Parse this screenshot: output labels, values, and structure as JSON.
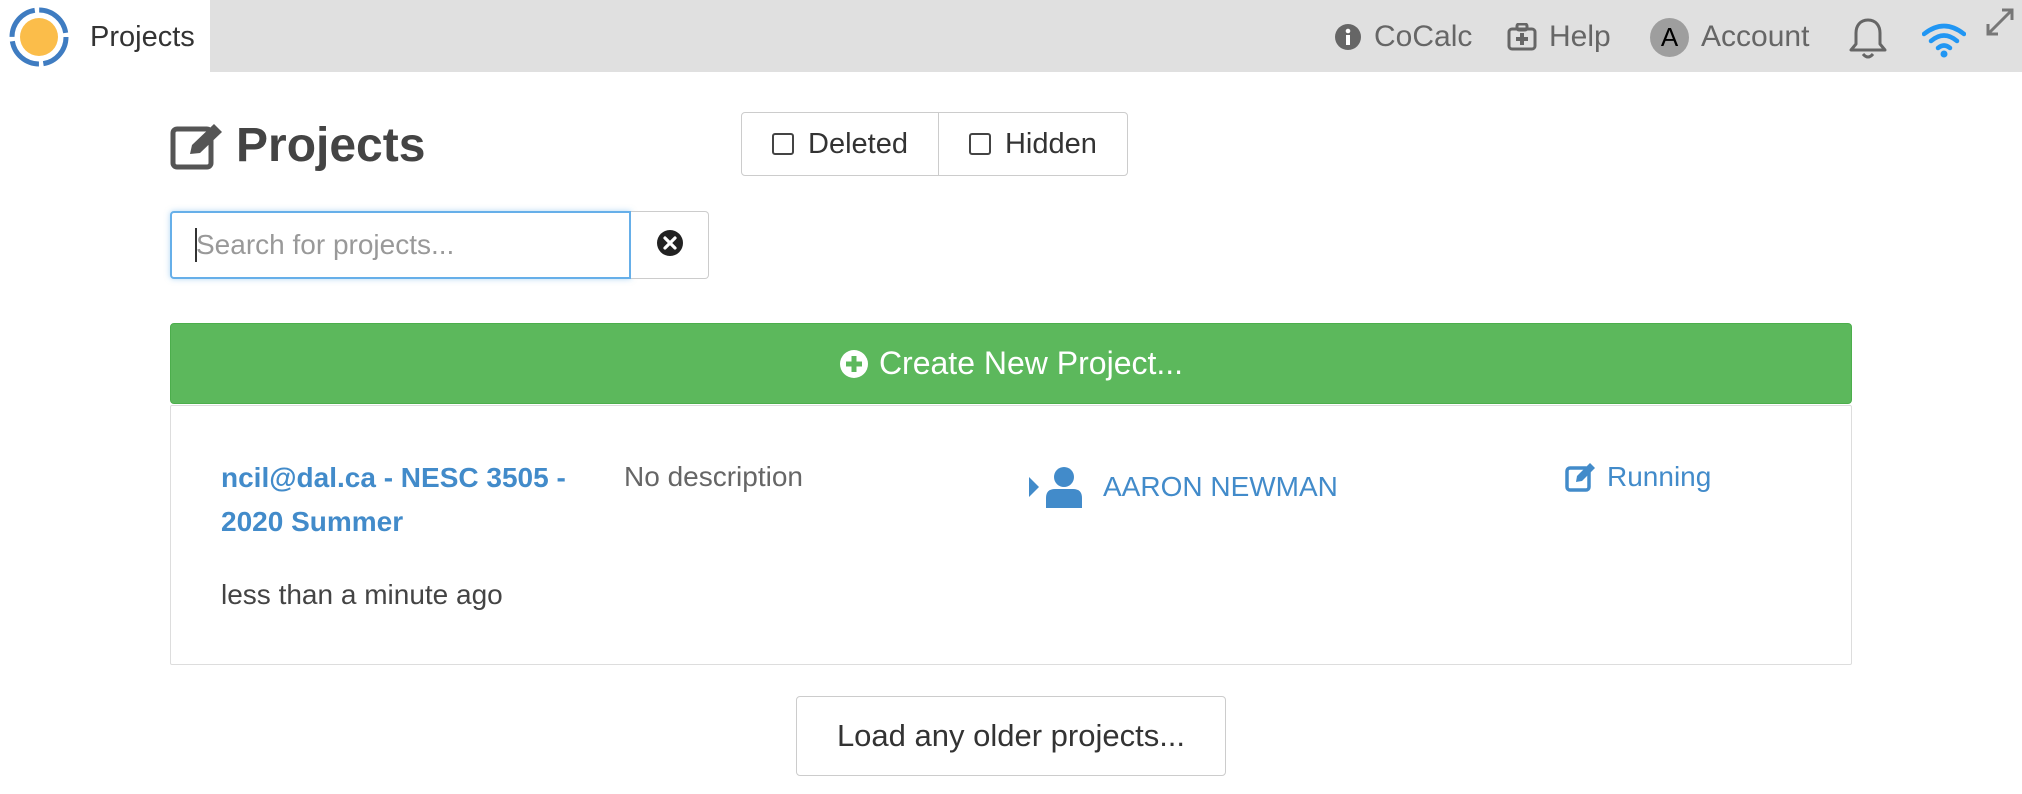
{
  "topbar": {
    "tab_label": "Projects",
    "nav": {
      "cocalc": "CoCalc",
      "help": "Help",
      "account": "Account",
      "avatar_letter": "A"
    }
  },
  "header": {
    "title": "Projects",
    "filters": {
      "deleted": "Deleted",
      "hidden": "Hidden"
    }
  },
  "search": {
    "placeholder": "Search for projects...",
    "value": ""
  },
  "create_button": "Create New Project...",
  "projects": [
    {
      "title": "ncil@dal.ca - NESC 3505 - 2020 Summer",
      "description": "No description",
      "last_edited": "less than a minute ago",
      "user": "AARON NEWMAN",
      "status": "Running"
    }
  ],
  "load_older": "Load any older projects...",
  "colors": {
    "accent_blue": "#428bca",
    "create_green": "#5cb85c",
    "logo_orange": "#fbbd4a",
    "logo_ring": "#3f7cc1",
    "wifi_blue": "#2196f3"
  },
  "icons": {
    "logo": "cocalc-logo-icon",
    "cocalc": "info-circle-icon",
    "help": "medkit-icon",
    "notifications": "bell-icon",
    "connection": "wifi-icon",
    "fullscreen": "expand-icon",
    "heading": "edit-icon",
    "clear_search": "times-circle-icon",
    "create": "plus-circle-icon",
    "users_toggle": "caret-right-icon",
    "user": "user-icon",
    "status": "edit-icon"
  }
}
